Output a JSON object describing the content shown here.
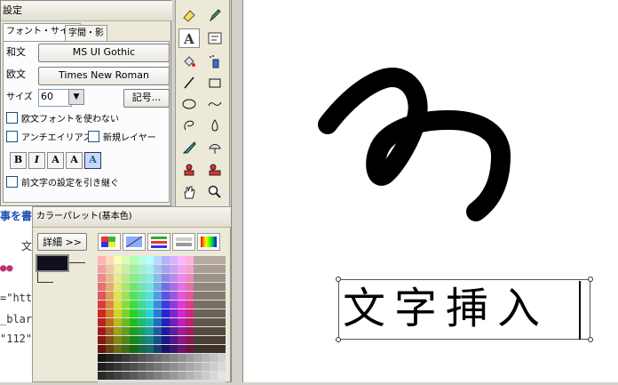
{
  "settings": {
    "title": "設定",
    "tabs": [
      {
        "label": "フォント・サイズ",
        "active": true
      },
      {
        "label": "字間・影",
        "active": false
      }
    ],
    "japanese_font_label": "和文",
    "japanese_font_value": "MS UI Gothic",
    "western_font_label": "欧文",
    "western_font_value": "Times New Roman",
    "size_label": "サイズ",
    "size_value": "60",
    "symbol_button": "記号...",
    "use_western_font": "欧文フォントを使わない",
    "antialias": "アンチエイリアス",
    "new_layer": "新規レイヤー",
    "inherit_prev": "前文字の設定を引き継ぐ",
    "format_buttons": [
      "B",
      "I",
      "A",
      "A",
      "A"
    ]
  },
  "palette": {
    "title": "カラーパレット(基本色)",
    "detail_button": "詳細 >>",
    "current_color": "#0f0f1e"
  },
  "canvas": {
    "inserted_text": "文字挿入"
  },
  "background": {
    "snippets": [
      "事を書",
      "文",
      "=\"http",
      "_blar",
      "\"112\""
    ]
  },
  "icons": [
    "eraser-icon",
    "pencil-icon",
    "text-tool-icon",
    "text-frame-icon",
    "fill-icon",
    "spray-icon",
    "line-icon",
    "rectangle-icon",
    "ellipse-icon",
    "curve-icon",
    "lasso-icon",
    "drop-icon",
    "pen-icon",
    "lamp-icon",
    "stamp-icon",
    "stamp2-icon",
    "hand-icon",
    "zoom-icon"
  ]
}
